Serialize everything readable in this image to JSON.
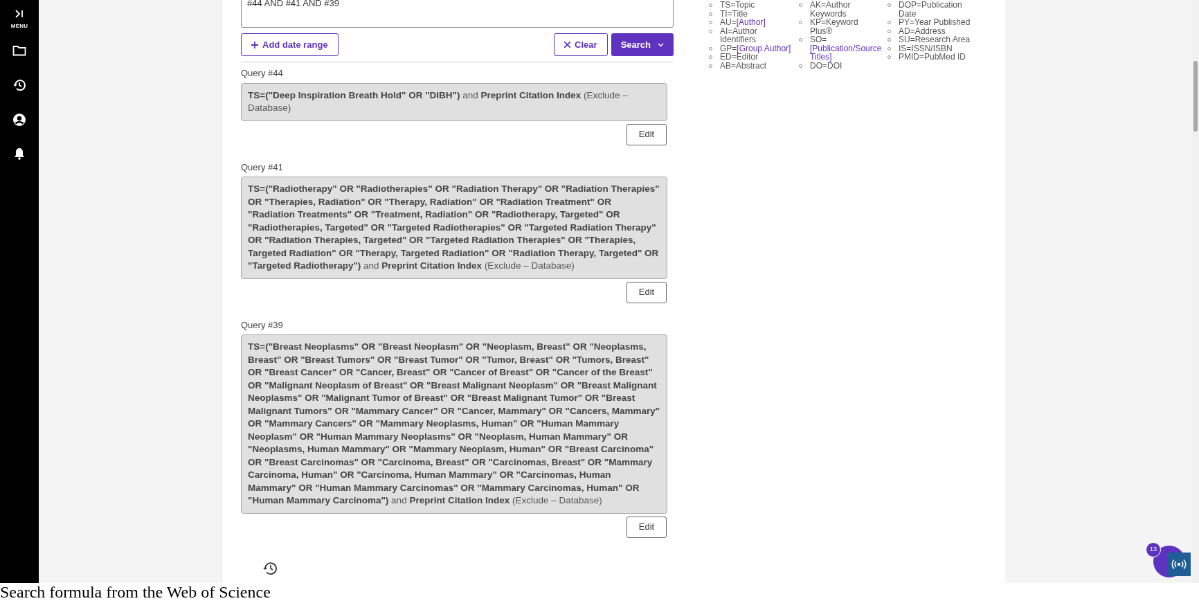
{
  "sidebar": {
    "menu_label": "MENU"
  },
  "query_box": {
    "value": "#44 AND #41 AND #39"
  },
  "buttons": {
    "add_date_range": "Add date range",
    "clear": "Clear",
    "search": "Search"
  },
  "queries": [
    {
      "label": "Query #44",
      "text": "**TS=(\"Deep Inspiration Breath Hold\" OR \"DIBH\")** and **Preprint Citation Index** (Exclude – Database)",
      "edit": "Edit"
    },
    {
      "label": "Query #41",
      "text": "**TS=(\"Radiotherapy\" OR \"Radiotherapies\" OR \"Radiation Therapy\" OR \"Radiation Therapies\" OR \"Therapies, Radiation\" OR \"Therapy, Radiation\" OR \"Radiation Treatment\" OR \"Radiation Treatments\" OR \"Treatment, Radiation\" OR \"Radiotherapy, Targeted\" OR \"Radiotherapies, Targeted\" OR \"Targeted Radiotherapies\" OR \"Targeted Radiation Therapy\" OR \"Radiation Therapies, Targeted\" OR \"Targeted Radiation Therapies\" OR \"Therapies, Targeted Radiation\" OR \"Therapy, Targeted Radiation\" OR \"Radiation Therapy, Targeted\" OR \"Targeted Radiotherapy\")** and **Preprint Citation Index** (Exclude – Database)",
      "edit": "Edit"
    },
    {
      "label": "Query #39",
      "text": "**TS=(\"Breast Neoplasms\" OR \"Breast Neoplasm\" OR \"Neoplasm, Breast\" OR \"Neoplasms, Breast\" OR \"Breast Tumors\" OR \"Breast Tumor\" OR \"Tumor, Breast\" OR \"Tumors, Breast\" OR \"Breast Cancer\" OR \"Cancer, Breast\" OR \"Cancer of Breast\" OR \"Cancer of the Breast\" OR \"Malignant Neoplasm of Breast\" OR \"Breast Malignant Neoplasm\" OR \"Breast Malignant Neoplasms\" OR \"Malignant Tumor of Breast\" OR \"Breast Malignant Tumor\" OR \"Breast Malignant Tumors\" OR \"Mammary Cancer\" OR \"Cancer, Mammary\" OR \"Cancers, Mammary\" OR \"Mammary Cancers\" OR \"Mammary Neoplasms, Human\" OR \"Human Mammary Neoplasm\" OR \"Human Mammary Neoplasms\" OR \"Neoplasm, Human Mammary\" OR \"Neoplasms, Human Mammary\" OR \"Mammary Neoplasm, Human\" OR \"Breast Carcinoma\" OR \"Breast Carcinomas\" OR \"Carcinoma, Breast\" OR \"Carcinomas, Breast\" OR \"Mammary Carcinoma, Human\" OR \"Carcinoma, Human Mammary\" OR \"Carcinomas, Human Mammary\" OR \"Human Mammary Carcinomas\" OR \"Mammary Carcinomas, Human\" OR \"Human Mammary Carcinoma\")** and **Preprint Citation Index** (Exclude – Database)",
      "edit": "Edit"
    }
  ],
  "field_tag_columns": [
    {
      "items": [
        {
          "text": "TS=Topic"
        },
        {
          "text": "TI=Title"
        },
        {
          "text": "AU=",
          "link": "[Author]"
        },
        {
          "text": "AI=Author Identifiers"
        },
        {
          "text": "GP=",
          "link": "[Group Author]"
        },
        {
          "text": "ED=Editor"
        },
        {
          "text": "AB=Abstract"
        }
      ]
    },
    {
      "items": [
        {
          "text": "AK=Author Keywords"
        },
        {
          "text": "KP=Keyword Plus®"
        },
        {
          "text": "SO=",
          "link": "[Publication/Source Titles]"
        },
        {
          "text": "DO=DOI"
        }
      ]
    },
    {
      "items": [
        {
          "text": "DOP=Publication Date"
        },
        {
          "text": "PY=Year Published"
        },
        {
          "text": "AD=Address"
        },
        {
          "text": "SU=Research Area"
        },
        {
          "text": "IS=ISSN/ISBN"
        },
        {
          "text": "PMID=PubMed ID"
        }
      ]
    }
  ],
  "chat_badge": "13",
  "caption": "Search formula from the Web of Science"
}
